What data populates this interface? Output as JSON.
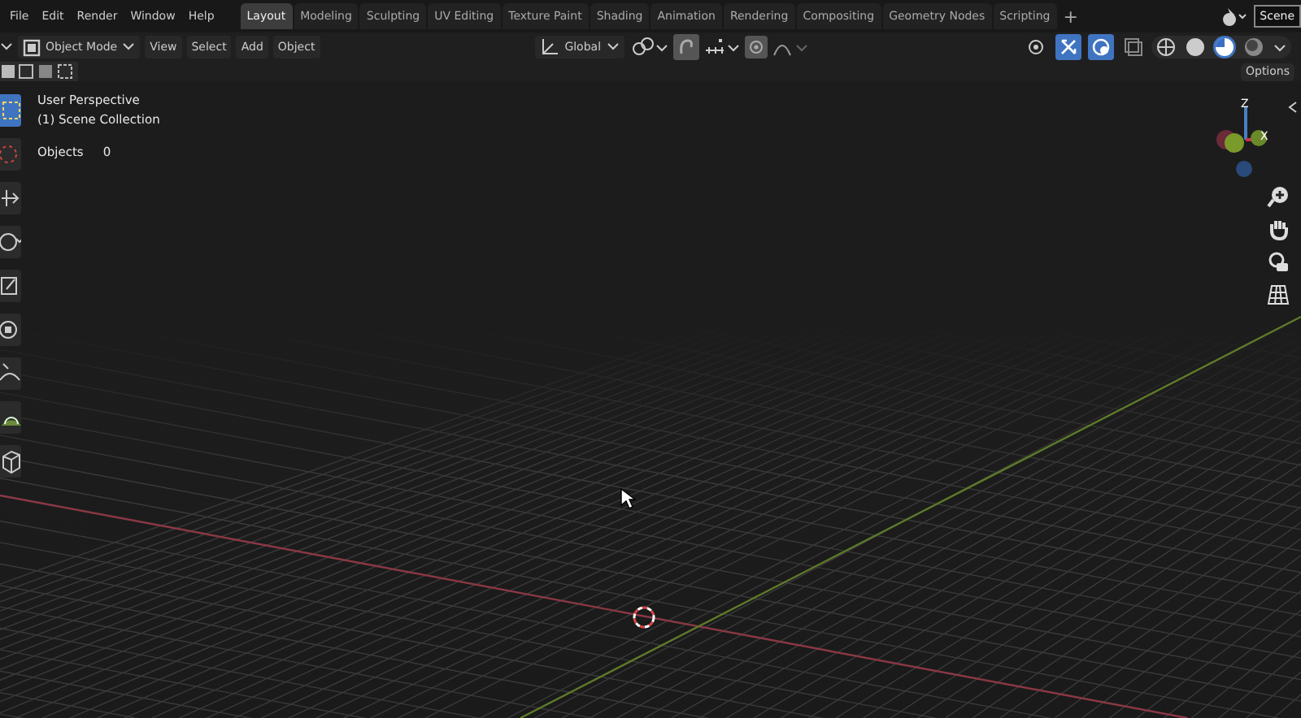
{
  "menus": [
    "File",
    "Edit",
    "Render",
    "Window",
    "Help"
  ],
  "workspaces": [
    {
      "label": "Layout",
      "selected": true
    },
    {
      "label": "Modeling",
      "selected": false
    },
    {
      "label": "Sculpting",
      "selected": false
    },
    {
      "label": "UV Editing",
      "selected": false
    },
    {
      "label": "Texture Paint",
      "selected": false
    },
    {
      "label": "Shading",
      "selected": false
    },
    {
      "label": "Animation",
      "selected": false
    },
    {
      "label": "Rendering",
      "selected": false
    },
    {
      "label": "Compositing",
      "selected": false
    },
    {
      "label": "Geometry Nodes",
      "selected": false
    },
    {
      "label": "Scripting",
      "selected": false
    }
  ],
  "add_workspace": "+",
  "scene": "Scene",
  "header": {
    "mode": "Object Mode",
    "menus": [
      "View",
      "Select",
      "Add",
      "Object"
    ],
    "orientation": "Global",
    "options": "Options"
  },
  "viewport_toggles": [
    {
      "kind": "visibility",
      "on": false
    },
    {
      "kind": "gizmo",
      "on": true
    },
    {
      "kind": "overlays",
      "on": true
    },
    {
      "kind": "xray",
      "on": false
    }
  ],
  "shading": [
    {
      "kind": "wireframe",
      "selected": false
    },
    {
      "kind": "solid",
      "selected": false
    },
    {
      "kind": "material",
      "selected": true
    },
    {
      "kind": "rendered",
      "selected": false
    }
  ],
  "overlay": {
    "view": "User Perspective",
    "collection": "(1) Scene Collection",
    "stat_label": "Objects",
    "stat_value": "0"
  },
  "tools": [
    {
      "kind": "select",
      "selected": true
    },
    {
      "kind": "cursor",
      "selected": false
    },
    {
      "kind": "move",
      "selected": false
    },
    {
      "kind": "rotate",
      "selected": false
    },
    {
      "kind": "scale",
      "selected": false
    },
    {
      "kind": "transform",
      "selected": false
    },
    {
      "kind": "annotate",
      "selected": false
    },
    {
      "kind": "measure",
      "selected": false
    },
    {
      "kind": "cube",
      "selected": false
    }
  ],
  "gizmo": {
    "z": "Z",
    "x": "X"
  }
}
